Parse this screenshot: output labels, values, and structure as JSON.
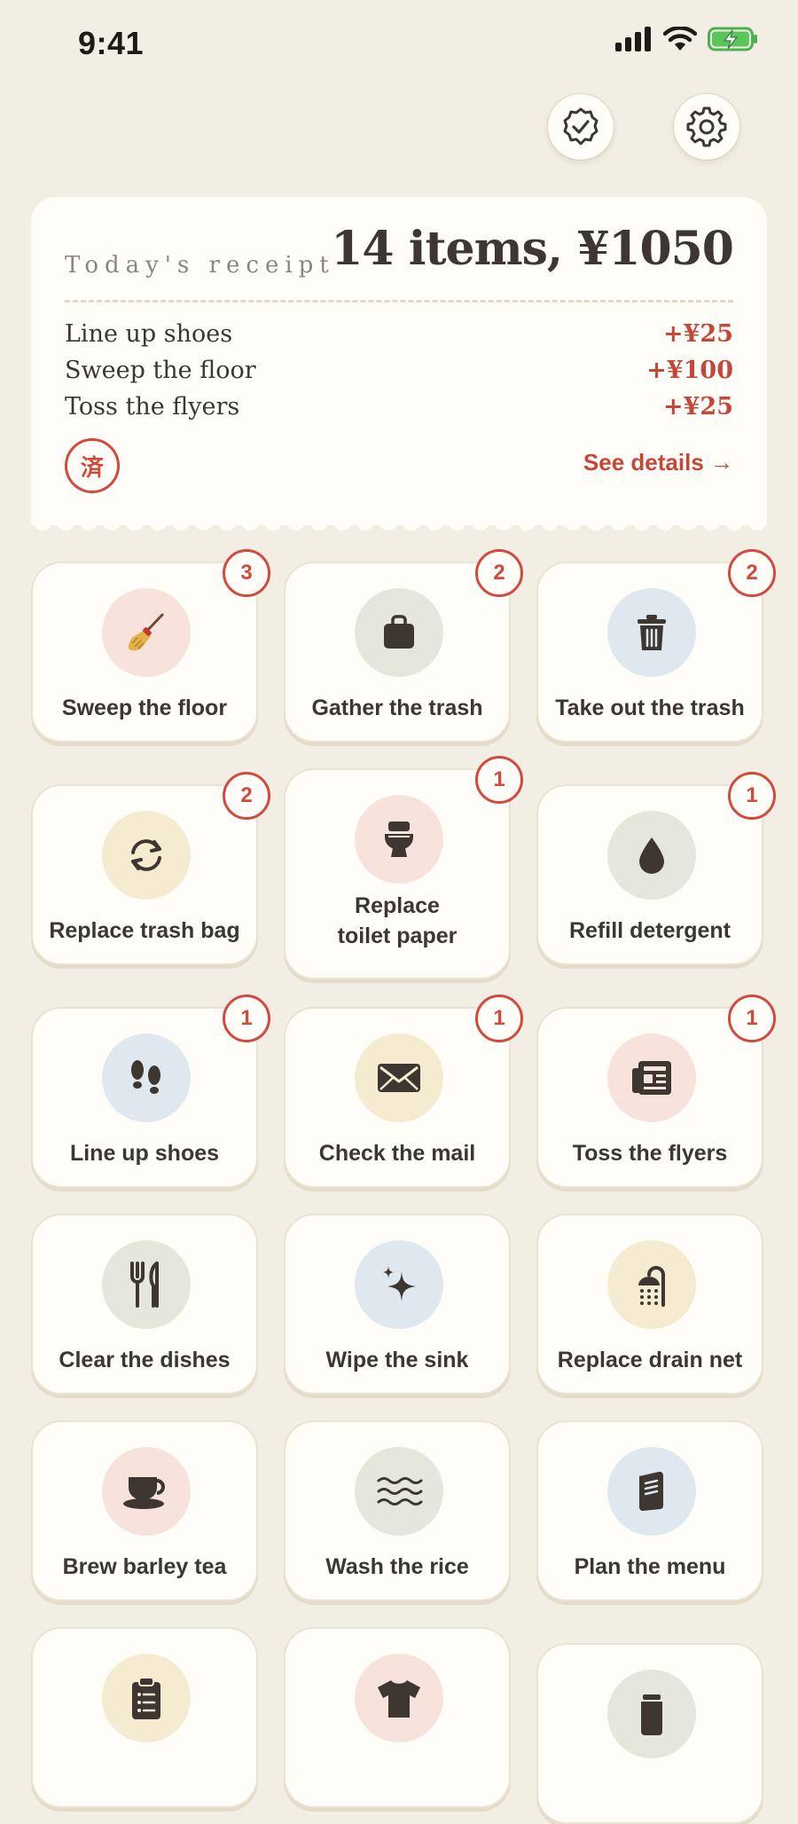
{
  "status": {
    "time": "9:41"
  },
  "receipt": {
    "label": "Today's receipt",
    "total": "14 items, ¥1050",
    "lines": [
      {
        "name": "Line up shoes",
        "amount": "+¥25"
      },
      {
        "name": "Sweep the floor",
        "amount": "+¥100"
      },
      {
        "name": "Toss the flyers",
        "amount": "+¥25"
      }
    ],
    "stamp": "済",
    "details_label": "See details →"
  },
  "chores": [
    {
      "label": "Sweep the floor",
      "badge": "3",
      "icon": "broom-icon",
      "color": "#f7e3dc"
    },
    {
      "label": "Gather the trash",
      "badge": "2",
      "icon": "bag-icon",
      "color": "#e5e7dc"
    },
    {
      "label": "Take out the trash",
      "badge": "2",
      "icon": "trash-can-icon",
      "color": "#dfe7ef"
    },
    {
      "label": "Replace trash bag",
      "badge": "2",
      "icon": "refresh-icon",
      "color": "#f5ebd0"
    },
    {
      "label_line1": "Replace",
      "label_line2": "toilet paper",
      "badge": "1",
      "icon": "toilet-icon",
      "color": "#f7e3dc"
    },
    {
      "label": "Refill detergent",
      "badge": "1",
      "icon": "droplet-icon",
      "color": "#e5e7dc"
    },
    {
      "label": "Line up shoes",
      "badge": "1",
      "icon": "footprints-icon",
      "color": "#dfe7ef"
    },
    {
      "label": "Check the mail",
      "badge": "1",
      "icon": "envelope-icon",
      "color": "#f5ebd0"
    },
    {
      "label": "Toss the flyers",
      "badge": "1",
      "icon": "newspaper-icon",
      "color": "#f7e3dc"
    },
    {
      "label": "Clear the dishes",
      "icon": "utensils-icon",
      "color": "#e5e7dc"
    },
    {
      "label": "Wipe the sink",
      "icon": "sparkle-icon",
      "color": "#dfe7ef"
    },
    {
      "label": "Replace drain net",
      "icon": "shower-icon",
      "color": "#f5ebd0"
    },
    {
      "label": "Brew barley tea",
      "icon": "cup-icon",
      "color": "#f7e3dc"
    },
    {
      "label": "Wash the rice",
      "icon": "water-waves-icon",
      "color": "#e5e7dc"
    },
    {
      "label": "Plan the menu",
      "icon": "book-icon",
      "color": "#dfe7ef"
    },
    {
      "icon": "clipboard-icon",
      "color": "#f5ebd0"
    },
    {
      "icon": "tshirt-icon",
      "color": "#f7e3dc"
    },
    {
      "icon": "jar-icon",
      "color": "#e5e7dc"
    }
  ],
  "colors": {
    "accent": "#c7463a",
    "background": "#f3eee3",
    "card": "#fffdf8",
    "text": "#3e3630"
  }
}
